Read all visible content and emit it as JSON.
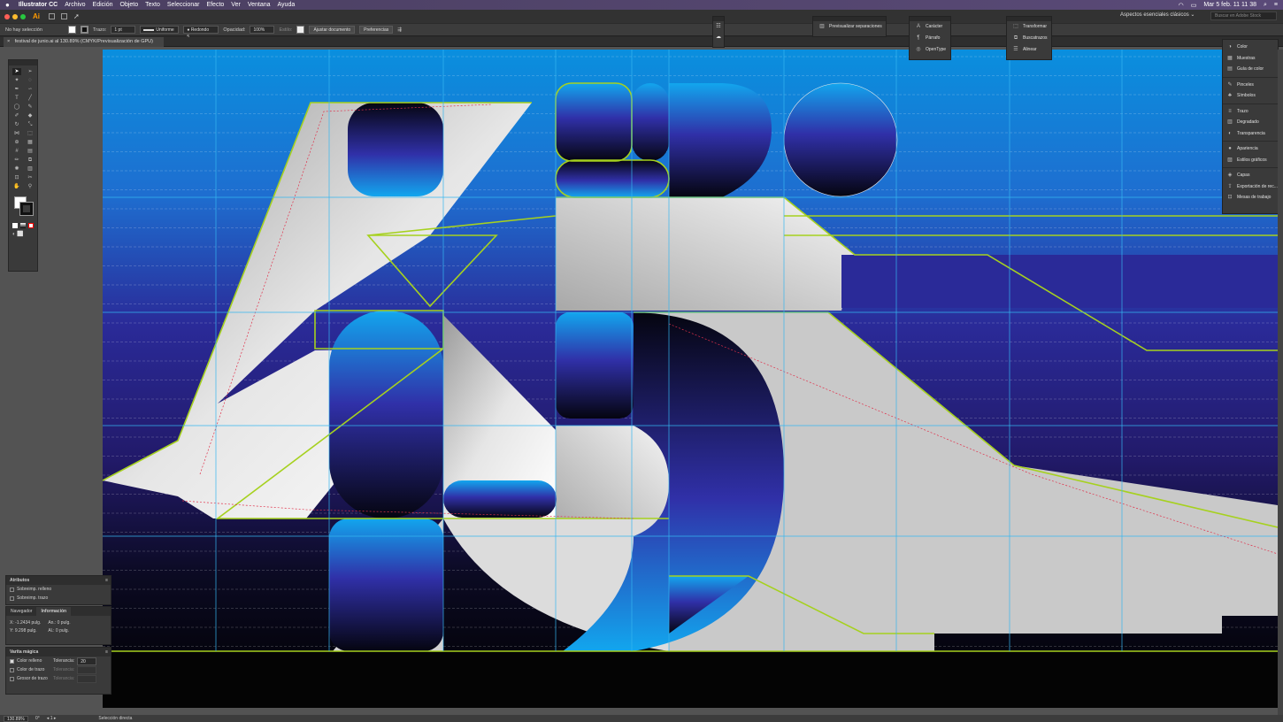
{
  "menubar": {
    "app": "Illustrator CC",
    "items": [
      "Archivo",
      "Edición",
      "Objeto",
      "Texto",
      "Seleccionar",
      "Efecto",
      "Ver",
      "Ventana",
      "Ayuda"
    ],
    "clock": "Mar 5 feb.  11 11 38"
  },
  "appbar": {
    "logo": "Ai",
    "workspace": "Aspectos esenciales clásicos ⌄",
    "search_placeholder": "Buscar en Adobe Stock"
  },
  "control": {
    "selection": "No hay selección",
    "stroke_label": "Trazo:",
    "stroke_value": "1 pt",
    "profile": "Uniforme",
    "brush": "Redondo 5...",
    "opacity_label": "Opacidad:",
    "opacity_value": "100%",
    "style_label": "Estilo:",
    "doc_button": "Ajustar documento",
    "prefs_button": "Preferencias"
  },
  "document": {
    "tab": "festival de junio.ai al 130.89% (CMYK/Previsualización de GPU)"
  },
  "floating": {
    "separations": "Previsualizar separaciones",
    "type": [
      "Carácter",
      "Párrafo",
      "OpenType"
    ],
    "transform": [
      "Transformar",
      "Buscatrazos",
      "Alinear"
    ]
  },
  "rightdock": {
    "groups": [
      [
        "Color",
        "Muestras",
        "Guía de color"
      ],
      [
        "Pinceles",
        "Símbolos"
      ],
      [
        "Trazo",
        "Degradado",
        "Transparencia"
      ],
      [
        "Apariencia",
        "Estilos gráficos"
      ],
      [
        "Capas",
        "Exportación de rec...",
        "Mesas de trabajo"
      ]
    ]
  },
  "attributes": {
    "title": "Atributos",
    "rows": [
      "Sobreimp. relleno",
      "Sobreimp. trazo"
    ]
  },
  "info": {
    "tabs": [
      "Navegador",
      "Información"
    ],
    "x": "X: -1.2434 pulg.",
    "y": "Y: 9.298 pulg.",
    "w": "An.: 0 pulg.",
    "h": "Al.: 0 pulg."
  },
  "magicwand": {
    "title": "Varita mágica",
    "rows": [
      {
        "label": "Color relleno",
        "tol_label": "Tolerancia:",
        "tol": "20",
        "checked": true
      },
      {
        "label": "Color de trazo",
        "tol_label": "Tolerancia:",
        "tol": "",
        "checked": false
      },
      {
        "label": "Grosor de trazo",
        "tol_label": "Tolerancia:",
        "tol": "",
        "checked": false
      }
    ]
  },
  "status": {
    "zoom": "130.89%",
    "angle": "0°",
    "artboard": "1",
    "tool": "Selección directa"
  },
  "colors": {
    "accent_green": "#a6d11f",
    "guide_cyan": "#35b6ef",
    "sky_top": "#0a8fde",
    "deep_blue": "#2a1e8c",
    "black": "#050505"
  }
}
